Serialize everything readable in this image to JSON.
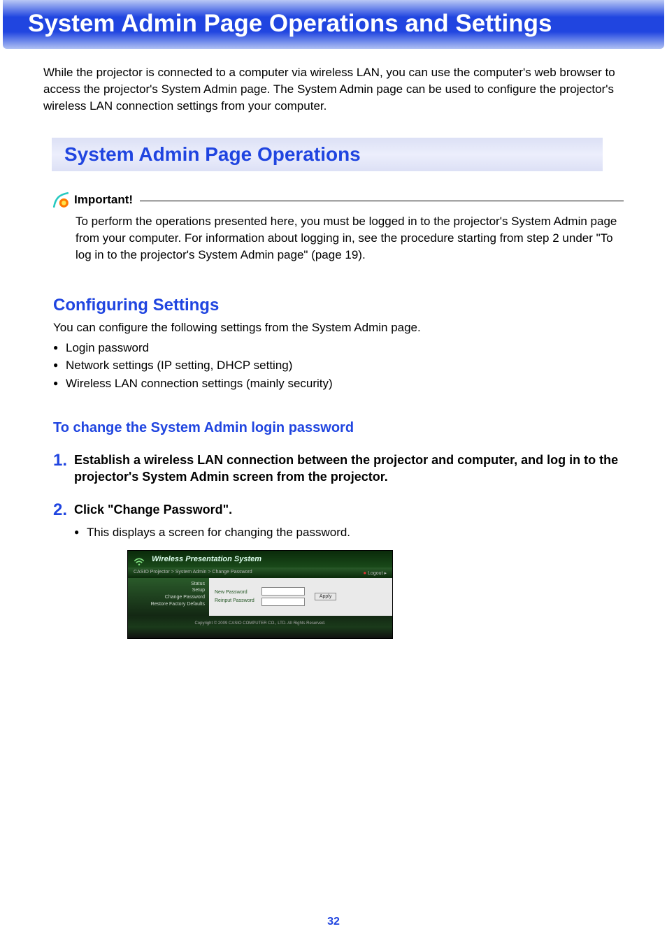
{
  "banner_title": "System Admin Page Operations and Settings",
  "intro": "While the projector is connected to a computer via wireless LAN, you can use the computer's web browser to access the projector's System Admin page. The System Admin page can be used to configure the projector's wireless LAN connection settings from your computer.",
  "section_title": "System Admin Page Operations",
  "important": {
    "title": "Important!",
    "body": "To perform the operations presented here, you must be logged in to the projector's System Admin page from your computer. For information about logging in, see the procedure starting from step 2 under \"To log in to the projector's System Admin page\" (page 19)."
  },
  "configuring": {
    "title": "Configuring Settings",
    "lead": "You can configure the following settings from the System Admin page.",
    "bullets": [
      "Login password",
      "Network settings (IP setting, DHCP setting)",
      "Wireless LAN connection settings (mainly security)"
    ]
  },
  "procedure_title": "To change the System Admin login password",
  "steps": [
    {
      "num": "1.",
      "text": "Establish a wireless LAN connection between the projector and computer, and log in to the projector's System Admin screen from the projector.",
      "subs": []
    },
    {
      "num": "2.",
      "text": "Click \"Change Password\".",
      "subs": [
        "This displays a screen for changing the password."
      ]
    }
  ],
  "screenshot": {
    "header": "Wireless Presentation System",
    "breadcrumb": "CASIO Projector > System Admin > Change Password",
    "logout": "Logout",
    "sidebar": [
      "Status",
      "Setup",
      "Change Password",
      "Restore Factory Defaults"
    ],
    "labels": {
      "new": "New Password",
      "reinput": "Reinput Password"
    },
    "apply": "Apply",
    "footer": "Copyright © 2009 CASIO COMPUTER CO., LTD. All Rights Reserved."
  },
  "page_number": "32"
}
